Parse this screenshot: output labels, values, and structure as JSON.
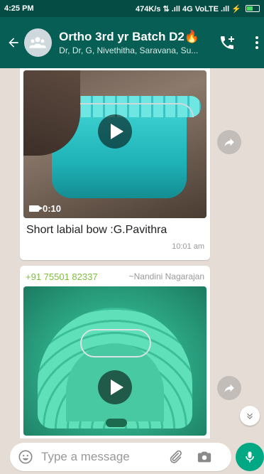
{
  "status": {
    "time": "4:25 PM",
    "indicators": "474K/s ⇅ .ıll 4G VoLTE .ıll ⚡"
  },
  "header": {
    "title": "Ortho 3rd yr Batch D2🔥",
    "subtitle": "Dr, Dr, G, Nivethitha, Saravana, Su..."
  },
  "messages": [
    {
      "duration": "0:10",
      "caption": "Short labial bow :G.Pavithra",
      "time": "10:01 am"
    },
    {
      "sender_phone": "+91 75501 82337",
      "sender_name": "~Nandini Nagarajan"
    }
  ],
  "composer": {
    "placeholder": "Type a message"
  },
  "colors": {
    "header": "#075e54",
    "status_bar": "#054d44",
    "accent": "#00a884",
    "chat_bg": "#e5ddd5"
  },
  "icons": [
    "back-arrow-icon",
    "group-avatar-icon",
    "add-call-icon",
    "more-menu-icon",
    "play-icon",
    "video-camera-icon",
    "share-icon",
    "chevron-down-icon",
    "emoji-icon",
    "paperclip-icon",
    "camera-icon",
    "mic-icon"
  ]
}
